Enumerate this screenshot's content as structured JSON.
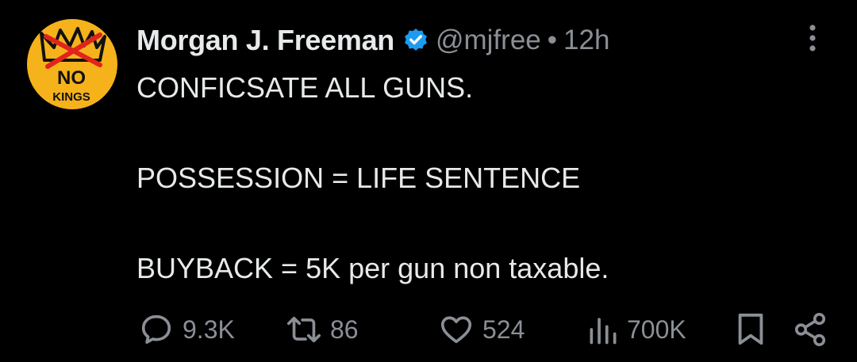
{
  "tweet": {
    "avatar": {
      "icon": "no-kings-logo",
      "top_text": "NO",
      "bottom_text": "KINGS",
      "background_color": "#f5b21b"
    },
    "author": {
      "name": "Morgan J. Freeman",
      "handle": "@mjfree",
      "separator": "•",
      "time": "12h",
      "verified_color": "#1d9bf0"
    },
    "body_lines": [
      "CONFICSATE ALL GUNS.",
      "",
      "POSSESSION = LIFE SENTENCE",
      "",
      "BUYBACK = 5K per gun non taxable."
    ],
    "actions": {
      "replies": "9.3K",
      "reposts": "86",
      "likes": "524",
      "views": "700K"
    }
  }
}
